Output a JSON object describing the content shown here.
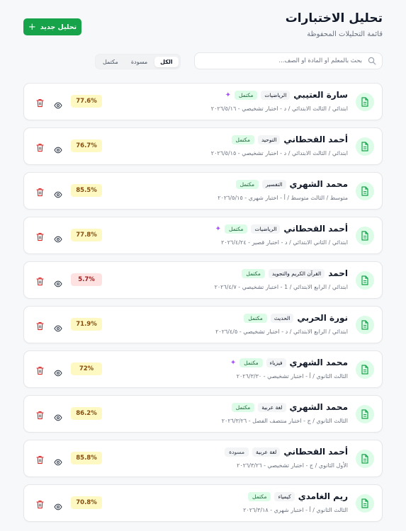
{
  "header": {
    "title": "تحليل الاختبارات",
    "subtitle": "قائمة التحليلات المحفوظة",
    "new_button": "تحليل جديد"
  },
  "search": {
    "placeholder": "بحث بالمعلم أو المادة أو الصف..."
  },
  "filters": [
    {
      "label": "الكل",
      "active": true
    },
    {
      "label": "مسودة",
      "active": false
    },
    {
      "label": "مكتمل",
      "active": false
    }
  ],
  "colors": {
    "accent": "#16a34a",
    "done_bg": "#dcfce7",
    "score_yellow": "#fef9c3",
    "score_red": "#fee2e2",
    "sparkle": "#a855f7"
  },
  "items": [
    {
      "name": "سارة العتيبي",
      "subject": "الرياضيات",
      "status": "مكتمل",
      "sparkle": true,
      "meta": "ابتدائي / الثالث الابتدائي / د - اختبار تشخيصي - ٢٠٢٦/٥/١٦",
      "score": "77.6%",
      "score_color": "yellow"
    },
    {
      "name": "أحمد القحطاني",
      "subject": "التوحيد",
      "status": "مكتمل",
      "sparkle": false,
      "meta": "ابتدائي / الثالث الابتدائي / د - اختبار تشخيصي - ٢٠٢٦/٥/١٥",
      "score": "76.7%",
      "score_color": "yellow"
    },
    {
      "name": "محمد الشهري",
      "subject": "التفسير",
      "status": "مكتمل",
      "sparkle": false,
      "meta": "متوسط / الثالث متوسط / أ - اختبار شهري - ٢٠٢٦/٥/١٥",
      "score": "85.5%",
      "score_color": "yellow"
    },
    {
      "name": "أحمد القحطاني",
      "subject": "الرياضيات",
      "status": "مكتمل",
      "sparkle": true,
      "meta": "ابتدائي / الثاني الابتدائي / د - اختبار قصير - ٢٠٢٦/٤/٢٤",
      "score": "77.8%",
      "score_color": "yellow"
    },
    {
      "name": "احمد",
      "subject": "القرآن الكريم والتجويد",
      "status": "مكتمل",
      "sparkle": false,
      "meta": "ابتدائي / الرابع الابتدائي / 1 - اختبار تشخيصي - ٢٠٢٦/٤/٧",
      "score": "5.7%",
      "score_color": "red"
    },
    {
      "name": "نورة الحربي",
      "subject": "الحديث",
      "status": "مكتمل",
      "sparkle": false,
      "meta": "ابتدائي / الرابع الابتدائي / د - اختبار تشخيصي - ٢٠٢٦/٤/٥",
      "score": "71.9%",
      "score_color": "yellow"
    },
    {
      "name": "محمد الشهري",
      "subject": "فيزياء",
      "status": "مكتمل",
      "sparkle": true,
      "meta": "الثالث الثانوي / أ - اختبار تشخيصي - ٢٠٢٦/٣/٣٠",
      "score": "72%",
      "score_color": "yellow"
    },
    {
      "name": "محمد الشهري",
      "subject": "لغة عربية",
      "status": "مكتمل",
      "sparkle": false,
      "meta": "الثالث الثانوي / ج - اختبار منتصف الفصل - ٢٠٢٦/٣/٢٦",
      "score": "86.2%",
      "score_color": "yellow"
    },
    {
      "name": "أحمد القحطاني",
      "subject": "لغة عربية",
      "status": "مسودة",
      "sparkle": false,
      "meta": "الأول الثانوي / ج - اختبار تشخيصي - ٢٠٢٦/٣/٢٦",
      "score": "85.8%",
      "score_color": "yellow"
    },
    {
      "name": "ريم الغامدي",
      "subject": "كيمياء",
      "status": "مكتمل",
      "sparkle": false,
      "meta": "الثالث الثانوي / أ - اختبار شهري - ٢٠٢٦/٣/١٨",
      "score": "70.8%",
      "score_color": "yellow"
    }
  ]
}
